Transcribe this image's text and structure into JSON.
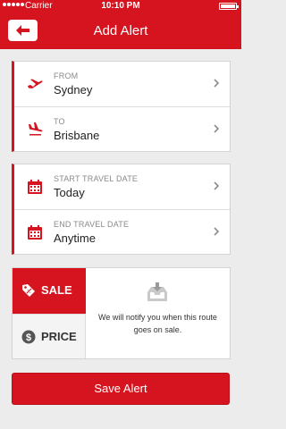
{
  "status_bar": {
    "carrier": "Carrier",
    "time": "10:10 PM"
  },
  "nav": {
    "title": "Add Alert"
  },
  "route": [
    {
      "label": "FROM",
      "value": "Sydney",
      "icon": "plane-takeoff-icon"
    },
    {
      "label": "TO",
      "value": "Brisbane",
      "icon": "plane-landing-icon"
    }
  ],
  "dates": [
    {
      "label": "START TRAVEL DATE",
      "value": "Today",
      "icon": "calendar-icon"
    },
    {
      "label": "END TRAVEL DATE",
      "value": "Anytime",
      "icon": "calendar-icon"
    }
  ],
  "alert_type": {
    "options": [
      {
        "label": "SALE",
        "selected": true,
        "icon": "sale-tag-icon"
      },
      {
        "label": "PRICE",
        "selected": false,
        "icon": "dollar-icon"
      }
    ],
    "message": "We will notify you when this route goes on sale."
  },
  "save_label": "Save Alert",
  "colors": {
    "accent": "#d6141f",
    "background": "#ececec"
  }
}
